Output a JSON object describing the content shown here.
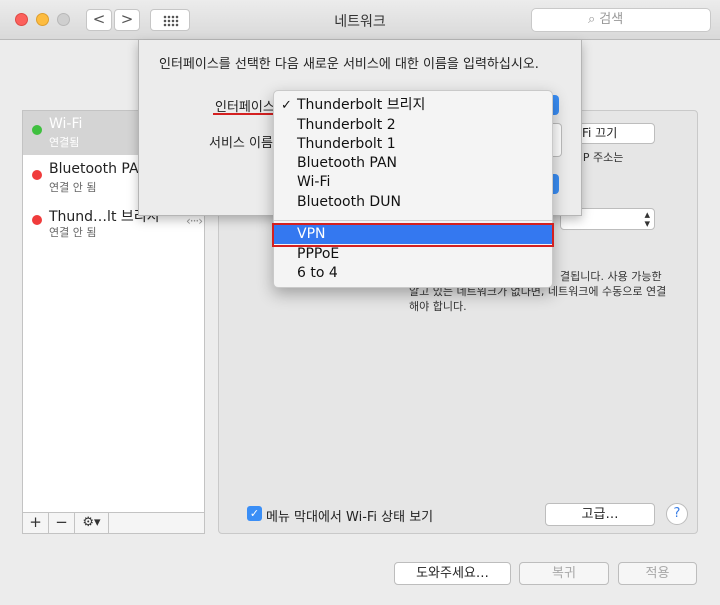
{
  "window": {
    "title": "네트워크",
    "search_placeholder": "검색",
    "nav_back_label": "<",
    "nav_forward_label": ">"
  },
  "sidebar": {
    "services": [
      {
        "name": "Wi-Fi",
        "status": "연결됨",
        "status_color": "#3fc03f",
        "selected": true
      },
      {
        "name": "Bluetooth PAN",
        "status": "연결 안 됨",
        "status_color": "#f03b3b",
        "selected": false
      },
      {
        "name": "Thund…lt 브리지",
        "status": "연결 안 됨",
        "status_color": "#f03b3b",
        "selected": false
      }
    ],
    "add_label": "+",
    "remove_label": "−",
    "gear_label": "⚙︎▾"
  },
  "panel": {
    "wifi_off_button": "Fi 끄기",
    "ip_note": "고 IP 주소는",
    "info_lines": [
      "결됩니다. 사용 가능한",
      "알고 있는 네트워크가 없다면, 네트워크에 수동으로 연결",
      "해야 합니다."
    ],
    "menubar_checkbox_label": "메뉴 막대에서 Wi-Fi 상태 보기",
    "advanced_button": "고급…",
    "help_button": "?"
  },
  "footer": {
    "assist_button": "도와주세요…",
    "revert_button": "복귀",
    "apply_button": "적용"
  },
  "sheet": {
    "prompt": "인터페이스를 선택한 다음 새로운 서비스에 대한 이름을 입력하십시오.",
    "interface_label": "인터페이스:",
    "service_name_label": "서비스 이름:"
  },
  "interface_menu": {
    "selected": "Thunderbolt 브리지",
    "highlighted": "VPN",
    "items": [
      "Thunderbolt 브리지",
      "Thunderbolt 2",
      "Thunderbolt 1",
      "Bluetooth PAN",
      "Wi-Fi",
      "Bluetooth DUN",
      "VPN",
      "PPPoE",
      "6 to 4"
    ]
  },
  "colors": {
    "accent": "#3478f0",
    "annotation_red": "#d42020"
  }
}
